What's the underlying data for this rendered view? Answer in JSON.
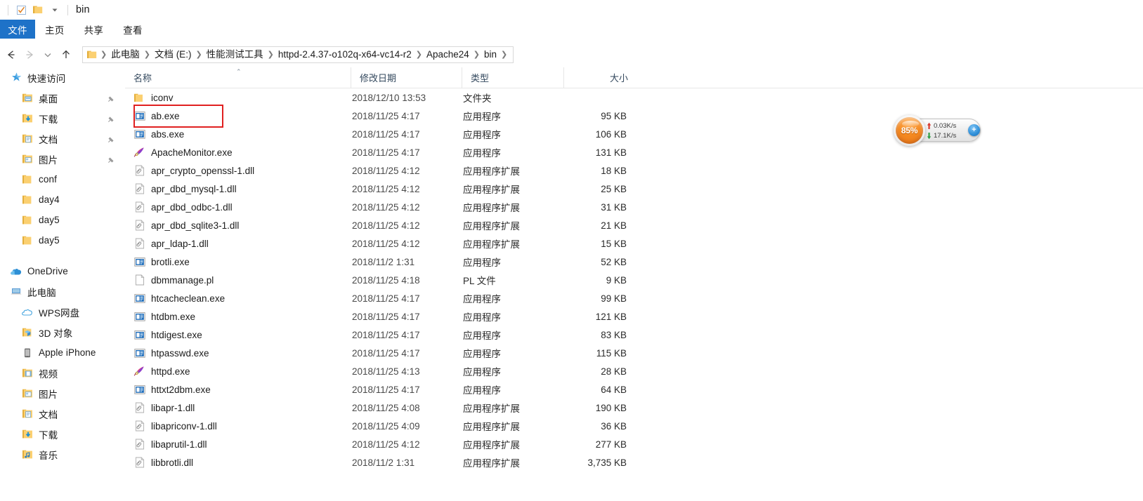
{
  "window": {
    "title": "bin",
    "qat": {
      "checkbox_icon": "checkbox-checked-icon",
      "folder_icon": "folder-icon",
      "dropdown_icon": "chevron-down-icon"
    }
  },
  "ribbon": {
    "tabs": [
      {
        "label": "文件",
        "active": true
      },
      {
        "label": "主页",
        "active": false
      },
      {
        "label": "共享",
        "active": false
      },
      {
        "label": "查看",
        "active": false
      }
    ]
  },
  "navigation": {
    "back_icon": "arrow-left-icon",
    "forward_icon": "arrow-right-icon",
    "history_icon": "chevron-down-icon",
    "up_icon": "arrow-up-icon",
    "breadcrumbs": [
      "此电脑",
      "文档 (E:)",
      "性能测试工具",
      "httpd-2.4.37-o102q-x64-vc14-r2",
      "Apache24",
      "bin"
    ],
    "separator": "❯"
  },
  "sidebar": {
    "groups": [
      {
        "header": {
          "label": "快速访问",
          "icon": "star-pin-icon"
        },
        "items": [
          {
            "label": "桌面",
            "icon": "desktop-folder-icon",
            "pinned": true
          },
          {
            "label": "下载",
            "icon": "downloads-folder-icon",
            "pinned": true
          },
          {
            "label": "文档",
            "icon": "documents-folder-icon",
            "pinned": true
          },
          {
            "label": "图片",
            "icon": "pictures-folder-icon",
            "pinned": true
          },
          {
            "label": "conf",
            "icon": "folder-icon",
            "pinned": false
          },
          {
            "label": "day4",
            "icon": "folder-icon",
            "pinned": false
          },
          {
            "label": "day5",
            "icon": "folder-icon",
            "pinned": false
          },
          {
            "label": "day5",
            "icon": "folder-icon",
            "pinned": false
          }
        ]
      },
      {
        "header": {
          "label": "OneDrive",
          "icon": "onedrive-cloud-icon"
        },
        "items": []
      },
      {
        "header": {
          "label": "此电脑",
          "icon": "this-pc-icon"
        },
        "items": [
          {
            "label": "WPS网盘",
            "icon": "cloud-outline-icon",
            "pinned": false
          },
          {
            "label": "3D 对象",
            "icon": "3d-objects-icon",
            "pinned": false
          },
          {
            "label": "Apple iPhone",
            "icon": "phone-device-icon",
            "pinned": false
          },
          {
            "label": "视频",
            "icon": "videos-folder-icon",
            "pinned": false
          },
          {
            "label": "图片",
            "icon": "pictures-folder-icon",
            "pinned": false
          },
          {
            "label": "文档",
            "icon": "documents-folder-icon",
            "pinned": false
          },
          {
            "label": "下载",
            "icon": "downloads-folder-icon",
            "pinned": false
          },
          {
            "label": "音乐",
            "icon": "music-folder-icon",
            "pinned": false
          }
        ]
      }
    ]
  },
  "filelist": {
    "columns": [
      {
        "label": "名称",
        "sorted": "asc",
        "caret": "⌃"
      },
      {
        "label": "修改日期",
        "sorted": "",
        "caret": ""
      },
      {
        "label": "类型",
        "sorted": "",
        "caret": ""
      },
      {
        "label": "大小",
        "sorted": "",
        "caret": ""
      }
    ],
    "rows": [
      {
        "name": "iconv",
        "date": "2018/12/10 13:53",
        "type": "文件夹",
        "size": "",
        "icon": "folder-icon"
      },
      {
        "name": "ab.exe",
        "date": "2018/11/25 4:17",
        "type": "应用程序",
        "size": "95 KB",
        "icon": "exe-icon",
        "annotated": true
      },
      {
        "name": "abs.exe",
        "date": "2018/11/25 4:17",
        "type": "应用程序",
        "size": "106 KB",
        "icon": "exe-icon"
      },
      {
        "name": "ApacheMonitor.exe",
        "date": "2018/11/25 4:17",
        "type": "应用程序",
        "size": "131 KB",
        "icon": "feather-pen-icon"
      },
      {
        "name": "apr_crypto_openssl-1.dll",
        "date": "2018/11/25 4:12",
        "type": "应用程序扩展",
        "size": "18 KB",
        "icon": "dll-icon"
      },
      {
        "name": "apr_dbd_mysql-1.dll",
        "date": "2018/11/25 4:12",
        "type": "应用程序扩展",
        "size": "25 KB",
        "icon": "dll-icon"
      },
      {
        "name": "apr_dbd_odbc-1.dll",
        "date": "2018/11/25 4:12",
        "type": "应用程序扩展",
        "size": "31 KB",
        "icon": "dll-icon"
      },
      {
        "name": "apr_dbd_sqlite3-1.dll",
        "date": "2018/11/25 4:12",
        "type": "应用程序扩展",
        "size": "21 KB",
        "icon": "dll-icon"
      },
      {
        "name": "apr_ldap-1.dll",
        "date": "2018/11/25 4:12",
        "type": "应用程序扩展",
        "size": "15 KB",
        "icon": "dll-icon"
      },
      {
        "name": "brotli.exe",
        "date": "2018/11/2 1:31",
        "type": "应用程序",
        "size": "52 KB",
        "icon": "exe-icon"
      },
      {
        "name": "dbmmanage.pl",
        "date": "2018/11/25 4:18",
        "type": "PL 文件",
        "size": "9 KB",
        "icon": "blank-file-icon"
      },
      {
        "name": "htcacheclean.exe",
        "date": "2018/11/25 4:17",
        "type": "应用程序",
        "size": "99 KB",
        "icon": "exe-icon"
      },
      {
        "name": "htdbm.exe",
        "date": "2018/11/25 4:17",
        "type": "应用程序",
        "size": "121 KB",
        "icon": "exe-icon"
      },
      {
        "name": "htdigest.exe",
        "date": "2018/11/25 4:17",
        "type": "应用程序",
        "size": "83 KB",
        "icon": "exe-icon"
      },
      {
        "name": "htpasswd.exe",
        "date": "2018/11/25 4:17",
        "type": "应用程序",
        "size": "115 KB",
        "icon": "exe-icon"
      },
      {
        "name": "httpd.exe",
        "date": "2018/11/25 4:13",
        "type": "应用程序",
        "size": "28 KB",
        "icon": "feather-pen-icon"
      },
      {
        "name": "httxt2dbm.exe",
        "date": "2018/11/25 4:17",
        "type": "应用程序",
        "size": "64 KB",
        "icon": "exe-icon"
      },
      {
        "name": "libapr-1.dll",
        "date": "2018/11/25 4:08",
        "type": "应用程序扩展",
        "size": "190 KB",
        "icon": "dll-icon"
      },
      {
        "name": "libapriconv-1.dll",
        "date": "2018/11/25 4:09",
        "type": "应用程序扩展",
        "size": "36 KB",
        "icon": "dll-icon"
      },
      {
        "name": "libaprutil-1.dll",
        "date": "2018/11/25 4:12",
        "type": "应用程序扩展",
        "size": "277 KB",
        "icon": "dll-icon"
      },
      {
        "name": "libbrotli.dll",
        "date": "2018/11/2 1:31",
        "type": "应用程序扩展",
        "size": "3,735 KB",
        "icon": "dll-icon"
      }
    ]
  },
  "monitor_widget": {
    "cpu_percent": "85%",
    "upload_speed": "0.03K/s",
    "download_speed": "17.1K/s",
    "upload_icon": "arrow-up-icon",
    "download_icon": "arrow-down-icon",
    "badge_label": "+",
    "accent_color": "#f58a20",
    "badge_color": "#2f8fd8"
  },
  "colors": {
    "tab_active_bg": "#1e72c8",
    "annotation_red": "#e02020",
    "folder_yellow": "#f8c850",
    "header_text": "#34495e"
  }
}
